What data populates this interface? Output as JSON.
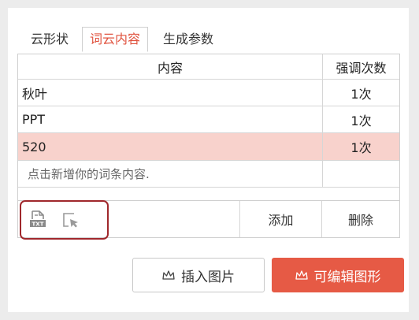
{
  "tabs": [
    {
      "label": "云形状",
      "active": false
    },
    {
      "label": "词云内容",
      "active": true
    },
    {
      "label": "生成参数",
      "active": false
    }
  ],
  "table": {
    "headers": [
      "内容",
      "强调次数"
    ],
    "rows": [
      {
        "content": "秋叶",
        "count": "1次"
      },
      {
        "content": "PPT",
        "count": "1次"
      },
      {
        "content": "520",
        "count": "1次",
        "selected": true
      }
    ],
    "placeholder": "点击新增你的词条内容."
  },
  "toolbar": {
    "add_label": "添加",
    "delete_label": "删除",
    "icons": [
      "txt-import-icon",
      "select-cursor-icon"
    ]
  },
  "buttons": {
    "insert_label": "插入图片",
    "edit_label": "可编辑图形"
  },
  "colors": {
    "accent": "#e65a45",
    "selected_row": "#f8d2cc",
    "highlight_outline": "#a0282c",
    "active_tab_text": "#e0523e"
  }
}
